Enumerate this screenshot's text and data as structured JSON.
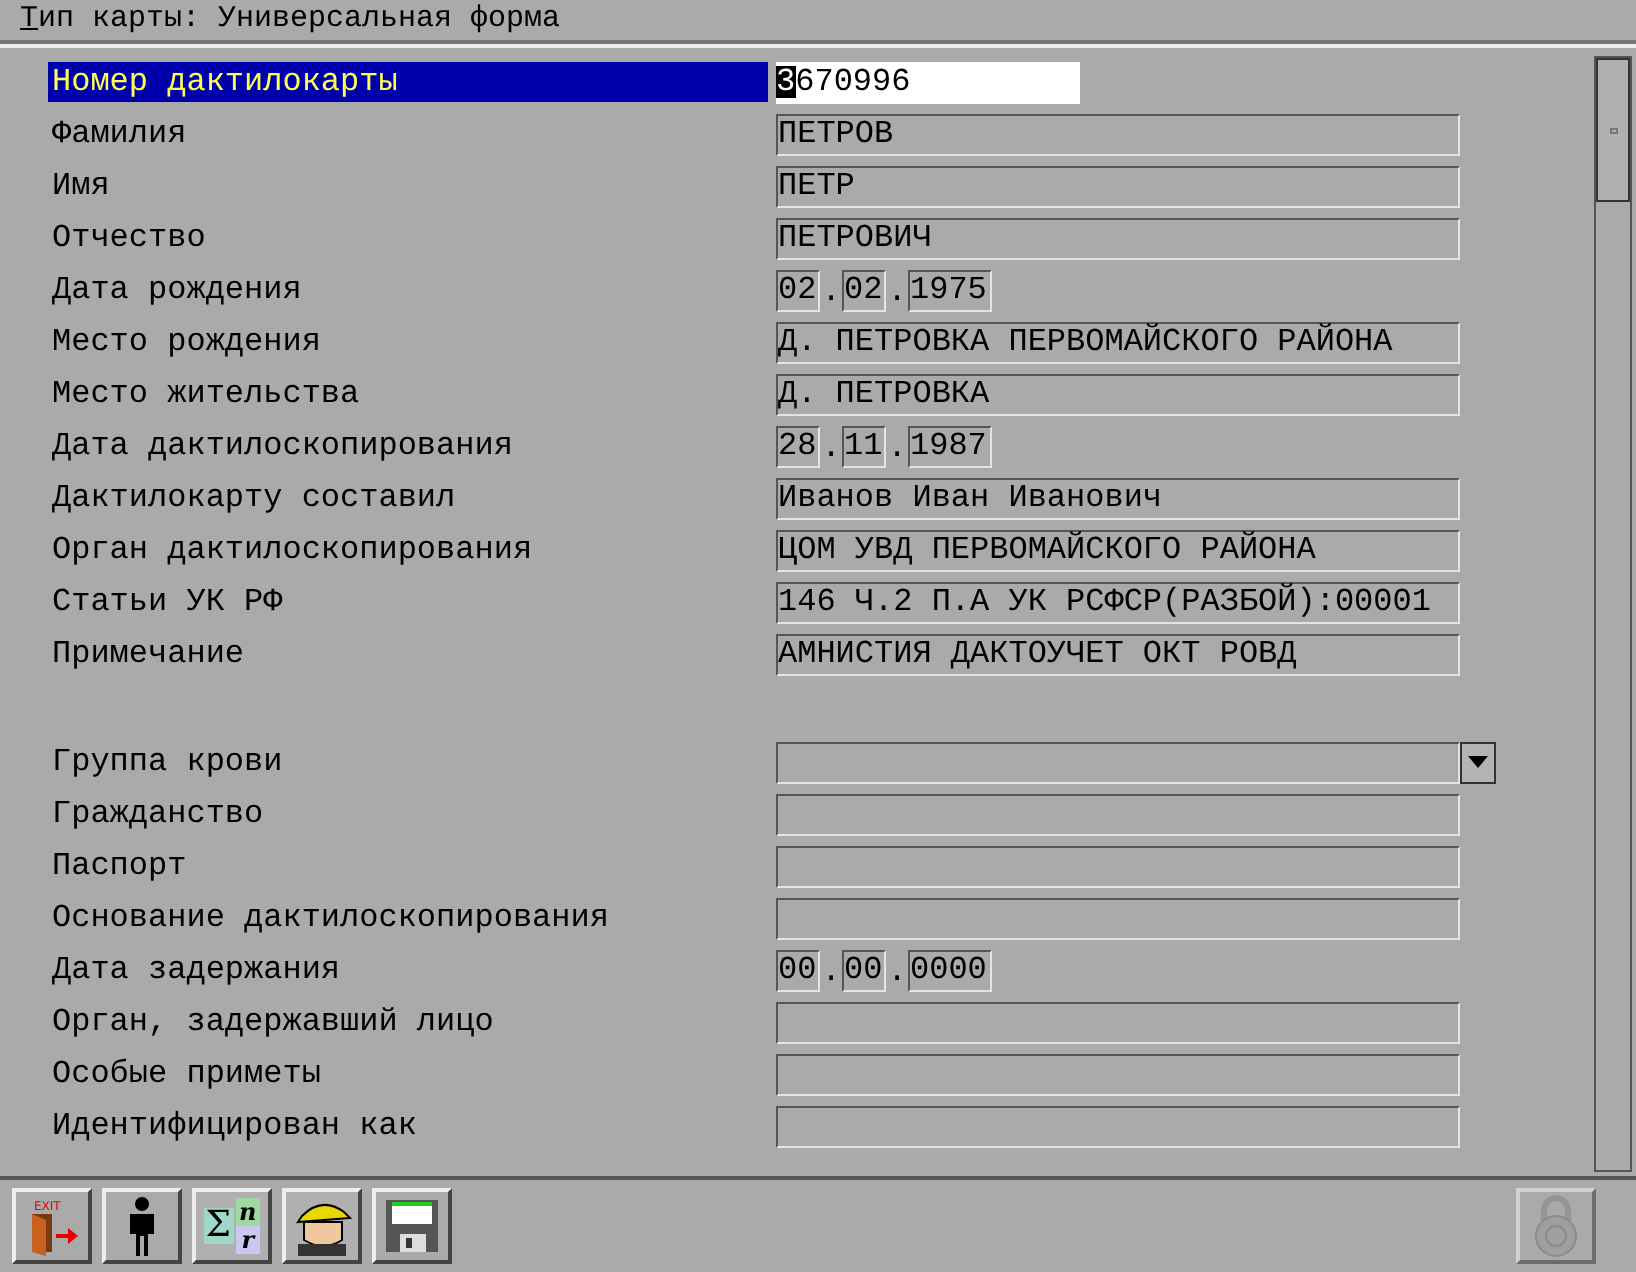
{
  "menu": {
    "hotkey": "Т",
    "title_rest": "ип карты: Универсальная форма"
  },
  "fields": [
    {
      "kind": "text",
      "label": "Номер дактилокарты",
      "value": "3670996",
      "selected": true
    },
    {
      "kind": "text",
      "label": "Фамилия",
      "value": "ПЕТРОВ",
      "selected": false
    },
    {
      "kind": "text",
      "label": "Имя",
      "value": "ПЕТР",
      "selected": false
    },
    {
      "kind": "text",
      "label": "Отчество",
      "value": "ПЕТРОВИЧ",
      "selected": false
    },
    {
      "kind": "date",
      "label": "Дата рождения",
      "day": "02",
      "sep1": ".",
      "month": "02",
      "sep2": ".",
      "year": "1975",
      "selected": false
    },
    {
      "kind": "text",
      "label": "Место рождения",
      "value": "Д. ПЕТРОВКА ПЕРВОМАЙСКОГО РАЙОНА",
      "selected": false
    },
    {
      "kind": "text",
      "label": "Место жительства",
      "value": "Д. ПЕТРОВКА",
      "selected": false
    },
    {
      "kind": "date",
      "label": "Дата дактилоскопирования",
      "day": "28",
      "sep1": ".",
      "month": "11",
      "sep2": ".",
      "year": "1987",
      "selected": false
    },
    {
      "kind": "text",
      "label": "Дактилокарту составил",
      "value": "Иванов Иван Иванович",
      "selected": false
    },
    {
      "kind": "text",
      "label": "Орган дактилоскопирования",
      "value": "ЦОМ УВД ПЕРВОМАЙСКОГО РАЙОНА",
      "selected": false
    },
    {
      "kind": "text",
      "label": "Статьи УК РФ",
      "value": "146 Ч.2 П.А УК РСФСР(РАЗБОЙ):00001",
      "selected": false
    },
    {
      "kind": "text",
      "label": "Примечание",
      "value": "АМНИСТИЯ ДАКТОУЧЕТ ОКТ РОВД",
      "selected": false
    }
  ],
  "extra_fields": [
    {
      "kind": "combo",
      "label": "Группа крови",
      "selected": false
    },
    {
      "kind": "text",
      "label": "Гражданство",
      "selected": false
    },
    {
      "kind": "text",
      "label": "Паспорт",
      "selected": false
    },
    {
      "kind": "text",
      "label": "Основание дактилоскопирования",
      "selected": false
    },
    {
      "kind": "date",
      "label": "Дата задержания",
      "day": "00",
      "sep1": ".",
      "month": "00",
      "sep2": ".",
      "year": "0000",
      "selected": false
    },
    {
      "kind": "text",
      "label": "Орган, задержавший лицо",
      "selected": false
    },
    {
      "kind": "text",
      "label": "Особые приметы",
      "selected": false
    },
    {
      "kind": "text",
      "label": "Идентифицирован как",
      "selected": false
    }
  ],
  "toolbar": [
    {
      "kind": "exit",
      "label": "EXIT",
      "disabled": false
    },
    {
      "kind": "person",
      "disabled": false
    },
    {
      "kind": "sigma",
      "symbol": "Σ",
      "sub_top": "n",
      "sub_bottom": "r",
      "disabled": false
    },
    {
      "kind": "agent",
      "disabled": false
    },
    {
      "kind": "save",
      "disabled": false
    },
    {
      "kind": "lock",
      "disabled": true
    }
  ]
}
